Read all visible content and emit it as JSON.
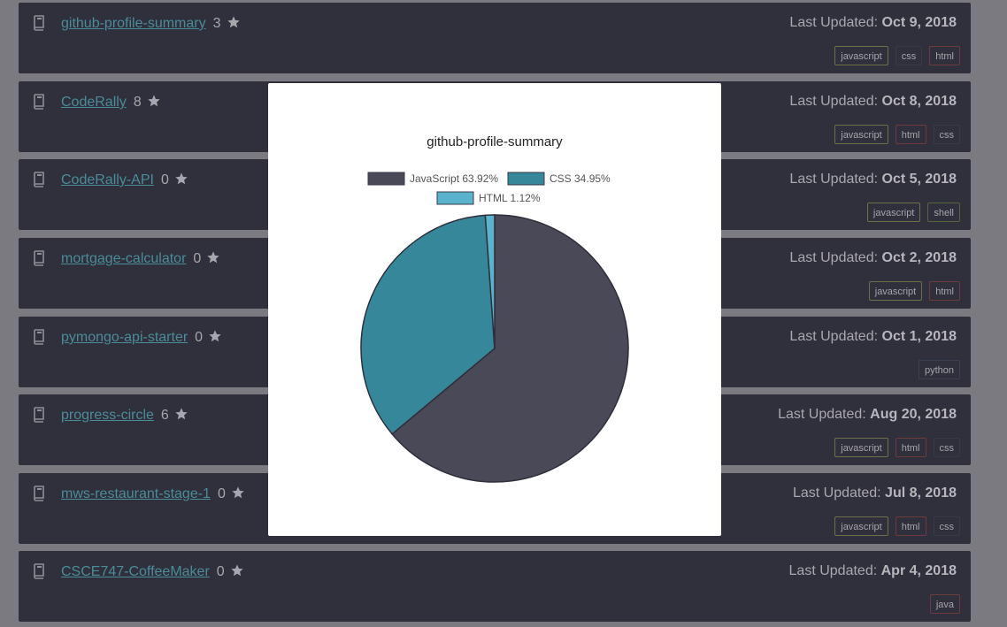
{
  "repos": [
    {
      "name": "github-profile-summary",
      "stars": "3",
      "updated_label": "Last Updated:",
      "updated_date": "Oct 9, 2018",
      "tags": [
        "javascript",
        "css",
        "html"
      ]
    },
    {
      "name": "CodeRally",
      "stars": "8",
      "updated_label": "Last Updated:",
      "updated_date": "Oct 8, 2018",
      "tags": [
        "javascript",
        "html",
        "css"
      ]
    },
    {
      "name": "CodeRally-API",
      "stars": "0",
      "updated_label": "Last Updated:",
      "updated_date": "Oct 5, 2018",
      "tags": [
        "javascript",
        "shell"
      ]
    },
    {
      "name": "mortgage-calculator",
      "stars": "0",
      "updated_label": "Last Updated:",
      "updated_date": "Oct 2, 2018",
      "tags": [
        "javascript",
        "html"
      ]
    },
    {
      "name": "pymongo-api-starter",
      "stars": "0",
      "updated_label": "Last Updated:",
      "updated_date": "Oct 1, 2018",
      "tags": [
        "python"
      ]
    },
    {
      "name": "progress-circle",
      "stars": "6",
      "updated_label": "Last Updated:",
      "updated_date": "Aug 20, 2018",
      "tags": [
        "javascript",
        "html",
        "css"
      ]
    },
    {
      "name": "mws-restaurant-stage-1",
      "stars": "0",
      "updated_label": "Last Updated:",
      "updated_date": "Jul 8, 2018",
      "tags": [
        "javascript",
        "html",
        "css"
      ]
    },
    {
      "name": "CSCE747-CoffeeMaker",
      "stars": "0",
      "updated_label": "Last Updated:",
      "updated_date": "Apr 4, 2018",
      "tags": [
        "java"
      ]
    }
  ],
  "icons": {
    "repo": "book-icon",
    "star": "star-icon"
  },
  "modal": {
    "chart_title": "github-profile-summary"
  },
  "chart_data": {
    "type": "pie",
    "title": "github-profile-summary",
    "legend_position": "top",
    "series": [
      {
        "name": "JavaScript 63.92%",
        "value": 63.92,
        "color": "#4a4958"
      },
      {
        "name": "CSS 34.95%",
        "value": 34.95,
        "color": "#36879a"
      },
      {
        "name": "HTML 1.12%",
        "value": 1.12,
        "color": "#5ab2cc"
      }
    ]
  }
}
